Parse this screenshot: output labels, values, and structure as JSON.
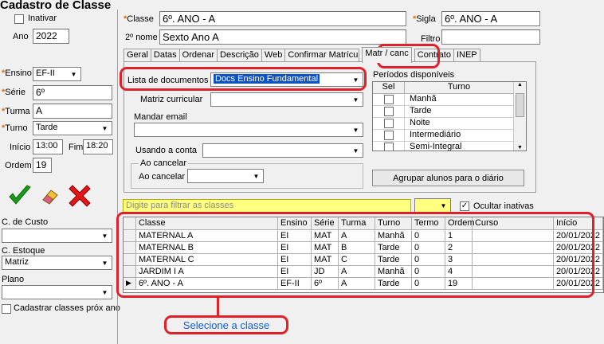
{
  "window": {
    "title": "Cadastro de Classe"
  },
  "left": {
    "inativar_label": "Inativar",
    "ano_label": "Ano",
    "ano_value": "2022",
    "ensino_label": "Ensino",
    "ensino_value": "EF-II",
    "serie_label": "Série",
    "serie_value": "6º",
    "turma_label": "Turma",
    "turma_value": "A",
    "turno_label": "Turno",
    "turno_value": "Tarde",
    "inicio_label": "Início",
    "inicio_value": "13:00",
    "fim_label": "Fim",
    "fim_value": "18:20",
    "ordem_label": "Ordem",
    "ordem_value": "19",
    "custo_label": "C. de Custo",
    "custo_value": "",
    "estoque_label": "C. Estoque",
    "estoque_value": "Matriz",
    "plano_label": "Plano",
    "plano_value": "",
    "cadastrar_label": "Cadastrar classes próx ano"
  },
  "header": {
    "classe_label": "Classe",
    "classe_value": "6º. ANO  - A",
    "sigla_label": "Sigla",
    "sigla_value": "6º. ANO  - A",
    "nome_label": "2º nome",
    "nome_value": "Sexto Ano A",
    "filtro_label": "Filtro",
    "filtro_value": ""
  },
  "tabs": [
    "Geral",
    "Datas",
    "Ordenar",
    "Descrição",
    "Web",
    "Confirmar Matrícula",
    "Matr / canc",
    "Contrato",
    "INEP"
  ],
  "matr": {
    "lista_label": "Lista de documentos",
    "lista_value": "Docs Ensino Fundamental",
    "matriz_label": "Matriz curricular",
    "matriz_value": "",
    "email_label": "Mandar email",
    "email_value": "",
    "conta_label": "Usando a conta",
    "conta_value": "",
    "cancelar_group": "Ao cancelar",
    "cancelar_label": "Ao cancelar",
    "cancelar_value": "",
    "periodos_label": "Períodos disponíveis",
    "periodos_headers": [
      "Sel",
      "Turno"
    ],
    "periodos": [
      "Manhã",
      "Tarde",
      "Noite",
      "Intermediário",
      "Semi-Integral"
    ],
    "agrupar_button": "Agrupar alunos para o diário"
  },
  "filter": {
    "placeholder": "Digite para filtrar as classes",
    "ocultar_label": "Ocultar inativas"
  },
  "grid": {
    "headers": [
      "Classe",
      "Ensino",
      "Série",
      "Turma",
      "Turno",
      "Termo",
      "Ordem",
      "Curso",
      "Início"
    ],
    "rows": [
      [
        "MATERNAL A",
        "EI",
        "MAT",
        "A",
        "Manhã",
        "0",
        "1",
        "",
        "20/01/2022"
      ],
      [
        "MATERNAL B",
        "EI",
        "MAT",
        "B",
        "Tarde",
        "0",
        "2",
        "",
        "20/01/2022"
      ],
      [
        "MATERNAL C",
        "EI",
        "MAT",
        "C",
        "Tarde",
        "0",
        "3",
        "",
        "20/01/2022"
      ],
      [
        "JARDIM I A",
        "EI",
        "JD",
        "A",
        "Manhã",
        "0",
        "4",
        "",
        "20/01/2022"
      ],
      [
        "6º. ANO  - A",
        "EF-II",
        "6º",
        "A",
        "Tarde",
        "0",
        "19",
        "",
        "20/01/2022"
      ]
    ]
  },
  "annotation": {
    "text": "Selecione a classe"
  },
  "colors": {
    "annotation_red": "#e0202a",
    "highlight_yellow": "#ffff80",
    "selection_blue": "#0a52c8"
  }
}
